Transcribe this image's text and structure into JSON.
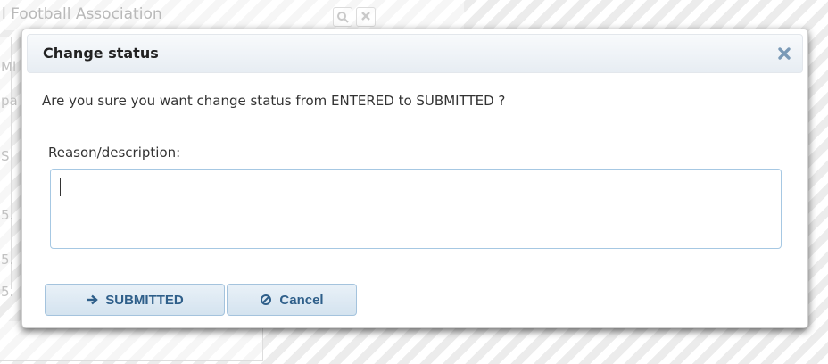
{
  "background": {
    "title": "l Football Association",
    "column_cells": [
      "Ml",
      "pa",
      "S",
      "5.",
      "5.",
      "5."
    ],
    "search_icon": "search-icon",
    "clear_icon": "close-icon"
  },
  "dialog": {
    "title": "Change status",
    "close_icon": "close-icon",
    "message": "Are you sure you want change status from ENTERED to SUBMITTED ?",
    "reason_label": "Reason/description:",
    "reason_value": "",
    "reason_placeholder": "",
    "buttons": {
      "submit": {
        "icon": "arrow-right-icon",
        "label": "SUBMITTED"
      },
      "cancel": {
        "icon": "cancel-icon",
        "label": "Cancel"
      }
    }
  },
  "colors": {
    "accent": "#2f5f8a",
    "close_icon": "#7a9ab7",
    "input_border": "#a6c8e3"
  }
}
